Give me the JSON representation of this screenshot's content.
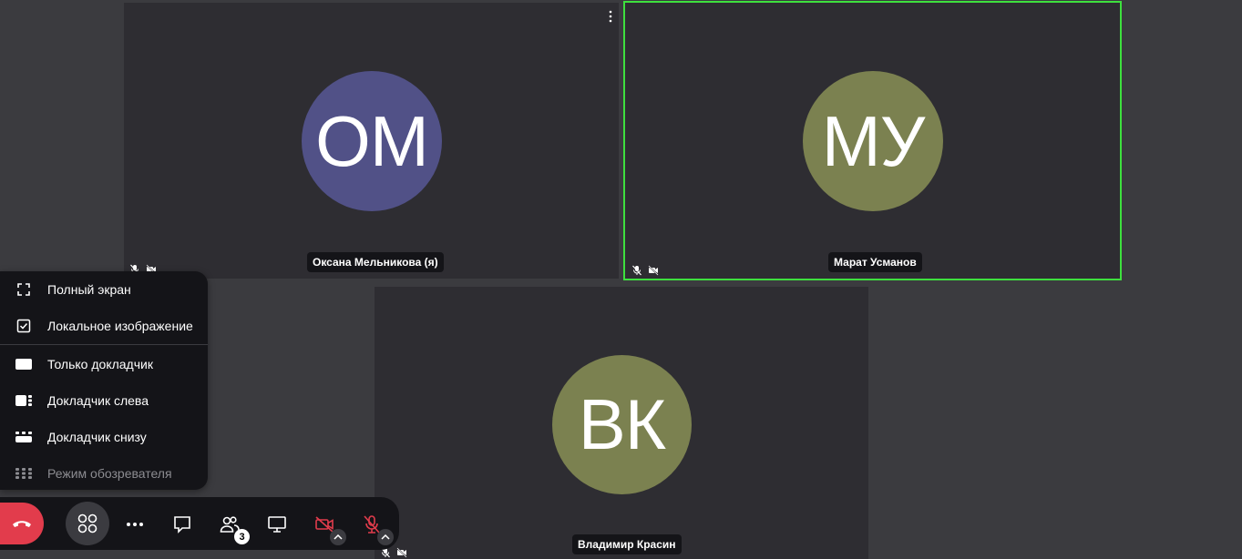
{
  "participants": [
    {
      "initials": "ОМ",
      "name": "Оксана Мельникова (я)",
      "avatar_color": "#515187"
    },
    {
      "initials": "МУ",
      "name": "Марат Усманов",
      "avatar_color": "#7b8150"
    },
    {
      "initials": "ВК",
      "name": "Владимир Красин",
      "avatar_color": "#7b8150"
    }
  ],
  "view_menu": {
    "items": [
      {
        "label": "Полный экран",
        "icon": "fullscreen-icon"
      },
      {
        "label": "Локальное изображение",
        "icon": "checkbox-checked-icon"
      },
      {
        "label": "Только докладчик",
        "icon": "speaker-only-icon"
      },
      {
        "label": "Докладчик слева",
        "icon": "speaker-left-icon"
      },
      {
        "label": "Докладчик снизу",
        "icon": "speaker-bottom-icon"
      },
      {
        "label": "Режим обозревателя",
        "icon": "grid-icon"
      }
    ]
  },
  "toolbar": {
    "participants_count": "3"
  },
  "colors": {
    "active_speaker_border": "#3ee03e",
    "hangup": "#e23c4c",
    "muted_red": "#e23c4c"
  }
}
